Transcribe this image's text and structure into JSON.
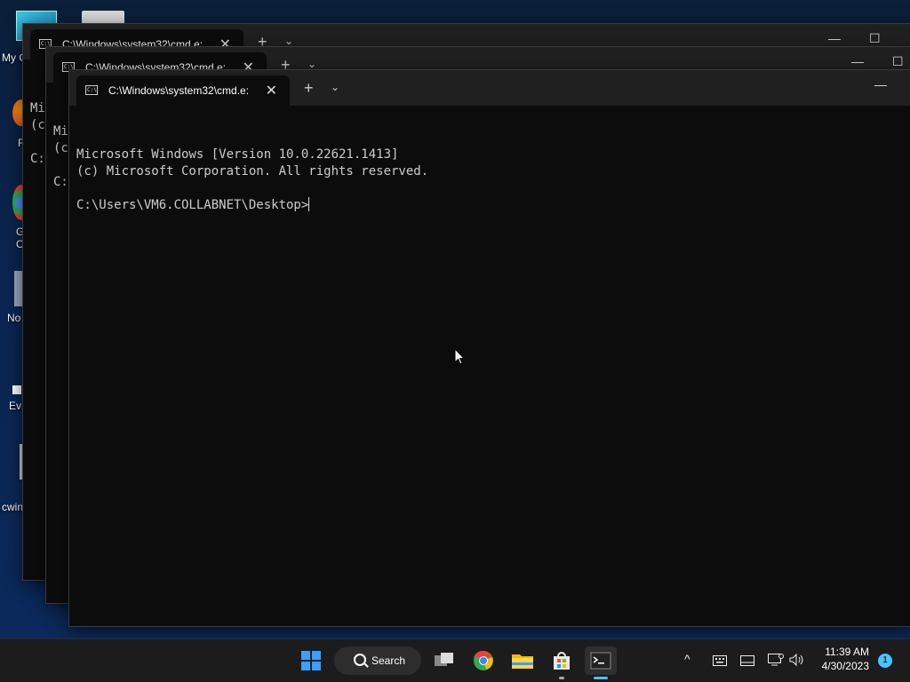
{
  "desktop": {
    "icons": [
      {
        "label": "My C"
      },
      {
        "label": "F"
      },
      {
        "label": "G\nC"
      },
      {
        "label": "No"
      },
      {
        "label": "Ev"
      },
      {
        "label": "cwin"
      }
    ]
  },
  "windows": [
    {
      "tab_title": "C:\\Windows\\system32\\cmd.e:",
      "console_lines": [
        "Mi",
        "(c",
        "",
        "C:"
      ]
    },
    {
      "tab_title": "C:\\Windows\\system32\\cmd.e:",
      "console_lines": [
        "Mi",
        "(c",
        "",
        "C:"
      ]
    },
    {
      "tab_title": "C:\\Windows\\system32\\cmd.e:",
      "console": {
        "line1": "Microsoft Windows [Version 10.0.22621.1413]",
        "line2": "(c) Microsoft Corporation. All rights reserved.",
        "prompt": "C:\\Users\\VM6.COLLABNET\\Desktop>"
      }
    }
  ],
  "controls": {
    "new_tab": "+",
    "dropdown": "⌄",
    "close_tab": "✕",
    "minimize": "—",
    "maximize": "☐"
  },
  "taskbar": {
    "search_label": "Search",
    "time": "11:39 AM",
    "date": "4/30/2023",
    "notification_count": "1",
    "tray_chevron": "^"
  }
}
